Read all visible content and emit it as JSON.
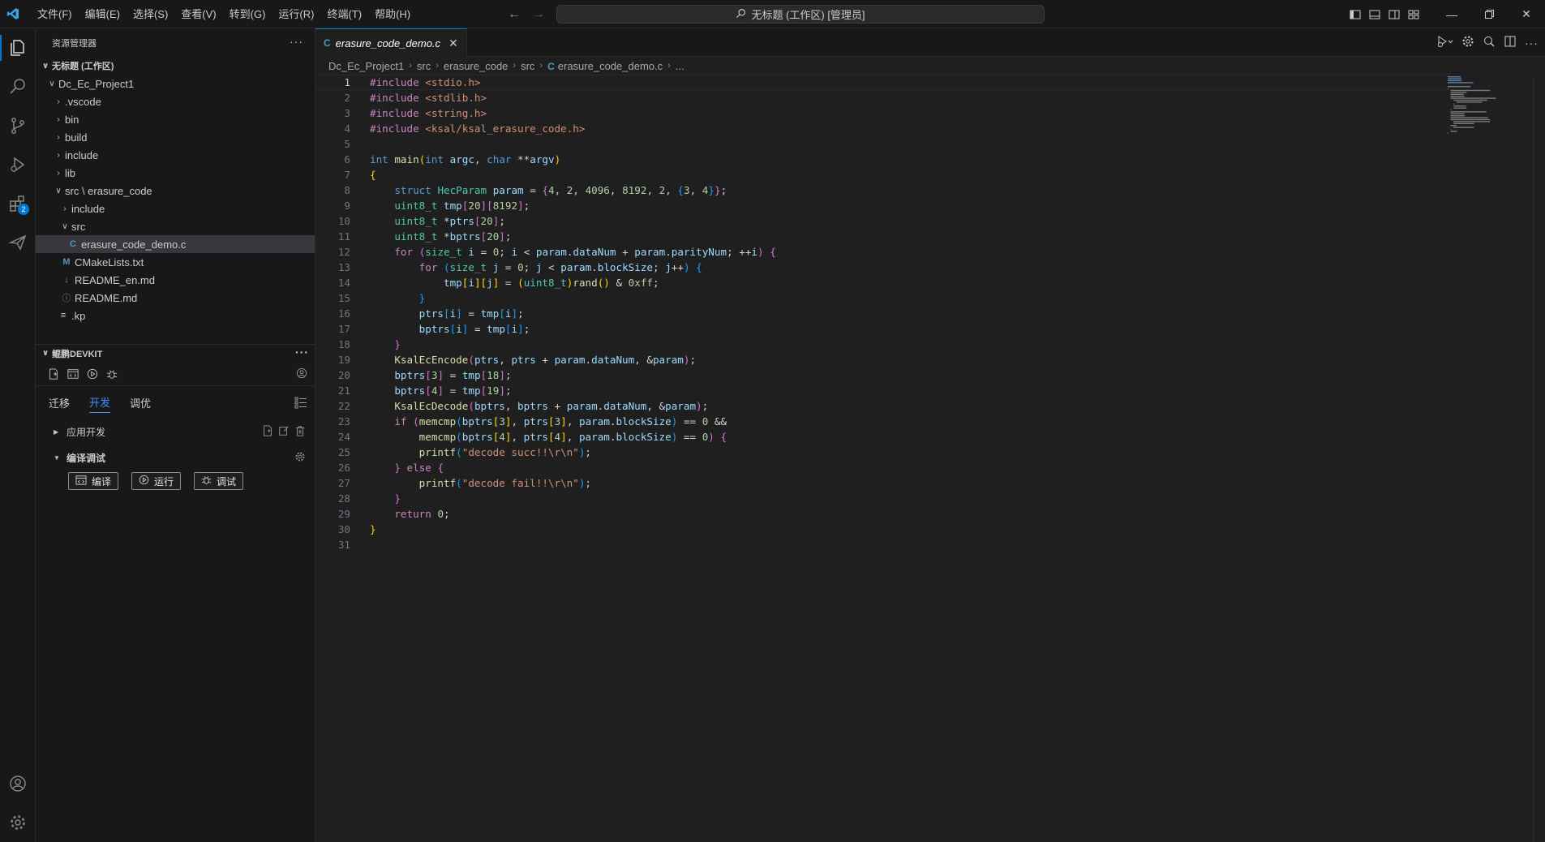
{
  "titlebar": {
    "menus": [
      "文件(F)",
      "编辑(E)",
      "选择(S)",
      "查看(V)",
      "转到(G)",
      "运行(R)",
      "终端(T)",
      "帮助(H)"
    ],
    "command_center": "无标题 (工作区) [管理员]"
  },
  "activitybar": {
    "items": [
      "explorer",
      "search",
      "source-control",
      "run-debug",
      "extensions",
      "devkit"
    ],
    "extensions_badge": "2"
  },
  "sidebar": {
    "title": "资源管理器",
    "workspace": "无标题 (工作区)",
    "project": "Dc_Ec_Project1",
    "tree": [
      {
        "label": ".vscode",
        "type": "folder"
      },
      {
        "label": "bin",
        "type": "folder"
      },
      {
        "label": "build",
        "type": "folder"
      },
      {
        "label": "include",
        "type": "folder"
      },
      {
        "label": "lib",
        "type": "folder"
      },
      {
        "label": "src \\ erasure_code",
        "type": "folder-open"
      },
      {
        "label": "include",
        "type": "folder"
      },
      {
        "label": "src",
        "type": "folder-open"
      },
      {
        "label": "erasure_code_demo.c",
        "type": "c-file"
      },
      {
        "label": "CMakeLists.txt",
        "type": "cmake-file"
      },
      {
        "label": "README_en.md",
        "type": "md-file"
      },
      {
        "label": "README.md",
        "type": "info-file"
      },
      {
        "label": ".kp",
        "type": "text-file"
      }
    ]
  },
  "devkit": {
    "title": "鲲鹏DEVKIT",
    "tabs": [
      "迁移",
      "开发",
      "调优"
    ],
    "active_tab": "开发",
    "group_app": "应用开发",
    "group_build": "编译调试",
    "btn_compile": "编译",
    "btn_run": "运行",
    "btn_debug": "调试"
  },
  "editor": {
    "tab_label": "erasure_code_demo.c",
    "breadcrumbs": [
      "Dc_Ec_Project1",
      "src",
      "erasure_code",
      "src",
      "erasure_code_demo.c",
      "..."
    ],
    "current_line": 1,
    "lines": [
      "#include <stdio.h>",
      "#include <stdlib.h>",
      "#include <string.h>",
      "#include <ksal/ksal_erasure_code.h>",
      "",
      "int main(int argc, char **argv)",
      "{",
      "    struct HecParam param = {4, 2, 4096, 8192, 2, {3, 4}};",
      "    uint8_t tmp[20][8192];",
      "    uint8_t *ptrs[20];",
      "    uint8_t *bptrs[20];",
      "    for (size_t i = 0; i < param.dataNum + param.parityNum; ++i) {",
      "        for (size_t j = 0; j < param.blockSize; j++) {",
      "            tmp[i][j] = (uint8_t)rand() & 0xff;",
      "        }",
      "        ptrs[i] = tmp[i];",
      "        bptrs[i] = tmp[i];",
      "    }",
      "    KsalEcEncode(ptrs, ptrs + param.dataNum, &param);",
      "    bptrs[3] = tmp[18];",
      "    bptrs[4] = tmp[19];",
      "    KsalEcDecode(bptrs, bptrs + param.dataNum, &param);",
      "    if (memcmp(bptrs[3], ptrs[3], param.blockSize) == 0 &&",
      "        memcmp(bptrs[4], ptrs[4], param.blockSize) == 0) {",
      "        printf(\"decode succ!!\\r\\n\");",
      "    } else {",
      "        printf(\"decode fail!!\\r\\n\");",
      "    }",
      "    return 0;",
      "}",
      ""
    ]
  },
  "colors": {
    "accent": "#0078d4",
    "link_tab": "#3794ff",
    "background": "#1f1f1f",
    "sidebar": "#181818"
  }
}
